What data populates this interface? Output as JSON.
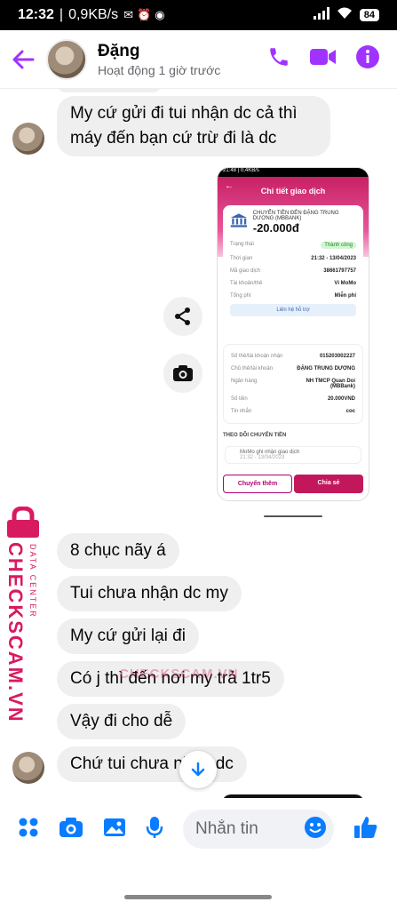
{
  "status_bar": {
    "time": "12:32",
    "network": "0,9KB/s",
    "battery": "84"
  },
  "header": {
    "name": "Đặng",
    "subtitle": "Hoạt động 1 giờ trước"
  },
  "messages": [
    {
      "text": "My cứ gửi đi tui nhận dc cả thì máy đến bạn cứ trừ đi là dc"
    },
    {
      "text": "8 chục nãy á"
    },
    {
      "text": "Tui chưa nhận dc my"
    },
    {
      "text": "My cứ gửi lại đi"
    },
    {
      "text": "Có j thì đến nơi my trả 1tr5"
    },
    {
      "text": "Vậy đi cho dễ"
    },
    {
      "text": "Chứ tui chưa nhận dc"
    }
  ],
  "screenshot": {
    "status": "21:48 | 0,4KB/s",
    "title": "Chi tiết giao dịch",
    "recipient_line": "CHUYỂN TIỀN ĐẾN ĐẶNG TRUNG DƯƠNG (MBBANK)",
    "amount": "-20.000đ",
    "status_label": "Trạng thái",
    "status_value": "Thành công",
    "time_label": "Thời gian",
    "time_value": "21:32 - 13/04/2023",
    "code_label": "Mã giao dịch",
    "code_value": "38661797757",
    "account_label": "Tài khoản/thẻ",
    "account_value": "Ví MoMo",
    "fee_label": "Tổng phí",
    "fee_value": "Miễn phí",
    "support": "Liên hệ hỗ trợ",
    "card_no_label": "Số thẻ/tài khoản nhận",
    "card_no_value": "015203002227",
    "owner_label": "Chủ thẻ/tài khoản",
    "owner_value": "ĐẶNG TRUNG DƯƠNG",
    "bank_label": "Ngân hàng",
    "bank_value": "NH TMCP Quan Doi (MBBank)",
    "sum_label": "Số tiền",
    "sum_value": "20.000VND",
    "message_label": "Tin nhắn",
    "message_value": "coc",
    "track_title": "THEO DÕI CHUYỂN TIỀN",
    "track_item": "MoMo ghi nhận giao dịch",
    "track_time": "21:32 - 13/04/2023",
    "btn_more": "Chuyển thêm",
    "btn_share": "Chia sẻ"
  },
  "watermark": {
    "brand": "CHECKSCAM.VN",
    "sub": "DATA CENTER"
  },
  "composer": {
    "placeholder": "Nhắn tin"
  },
  "colors": {
    "accent": "#a033ff",
    "messenger_blue": "#0a7cff",
    "momo_pink": "#c2185b"
  }
}
